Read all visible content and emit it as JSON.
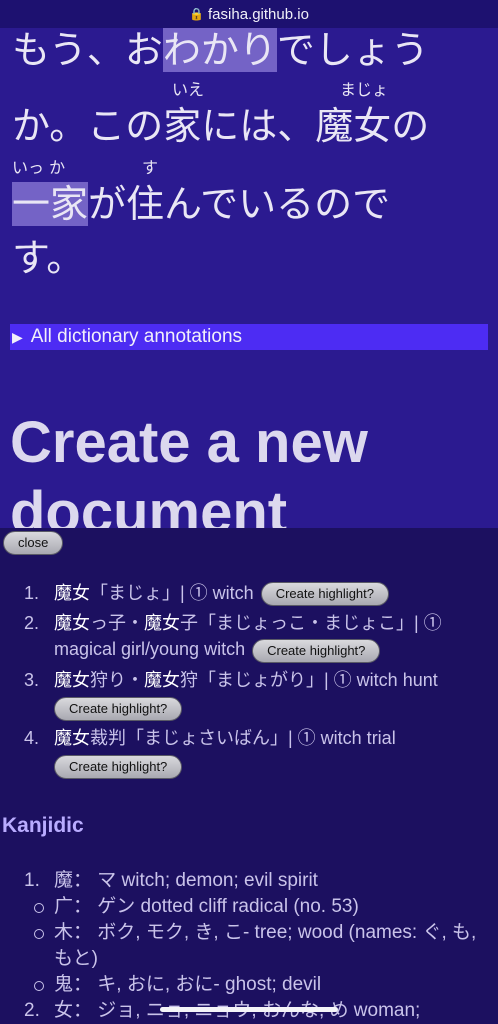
{
  "urlbar": {
    "lock_icon": "lock-icon",
    "domain": "fasiha.github.io"
  },
  "reader": {
    "line1": {
      "pre": "もう、お",
      "hl": "わかり",
      "post": "でしょう"
    },
    "line2": {
      "text": "か。この家には、魔女の",
      "furi_ie": "いえ",
      "furi_majo": "まじょ"
    },
    "line3": {
      "hl": "一家",
      "post": "が住んでいるので",
      "furi_ikka": "いっ か",
      "furi_su": "す"
    },
    "line4": {
      "text": "す。"
    },
    "details": {
      "label": "All dictionary annotations"
    },
    "create_heading": {
      "line1": "Create a new",
      "line2": "document"
    }
  },
  "panel": {
    "close_label": "close",
    "create_label": "Create highlight?",
    "entries": [
      {
        "num": "1.",
        "kw1": "魔女",
        "rest": "「まじょ」| ① witch"
      },
      {
        "num": "2.",
        "kw1": "魔女",
        "mid1": "っ子・",
        "kw2": "魔女",
        "mid2": "子「まじょっこ・まじょこ」| ①",
        "line2": "magical girl/young witch"
      },
      {
        "num": "3.",
        "kw1": "魔女",
        "mid1": "狩り・",
        "kw2": "魔女",
        "mid2": "狩「まじょがり」| ① witch hunt"
      },
      {
        "num": "4.",
        "kw1": "魔女",
        "mid1": "裁判「まじょさいばん」| ① witch trial"
      }
    ],
    "kanjidic_title": "Kanjidic",
    "kanji": [
      {
        "num": "1.",
        "text": "魔： マ witch; demon; evil spirit",
        "subs": [
          "广： ゲン dotted cliff radical (no. 53)",
          "木： ボク, モク, き, こ- tree; wood (names: ぐ, も, もと)",
          "鬼： キ, おに, おに- ghost; devil"
        ]
      },
      {
        "num": "2.",
        "text": "女： ジョ, ニョ, ニョウ, おんな, め woman;"
      }
    ]
  }
}
